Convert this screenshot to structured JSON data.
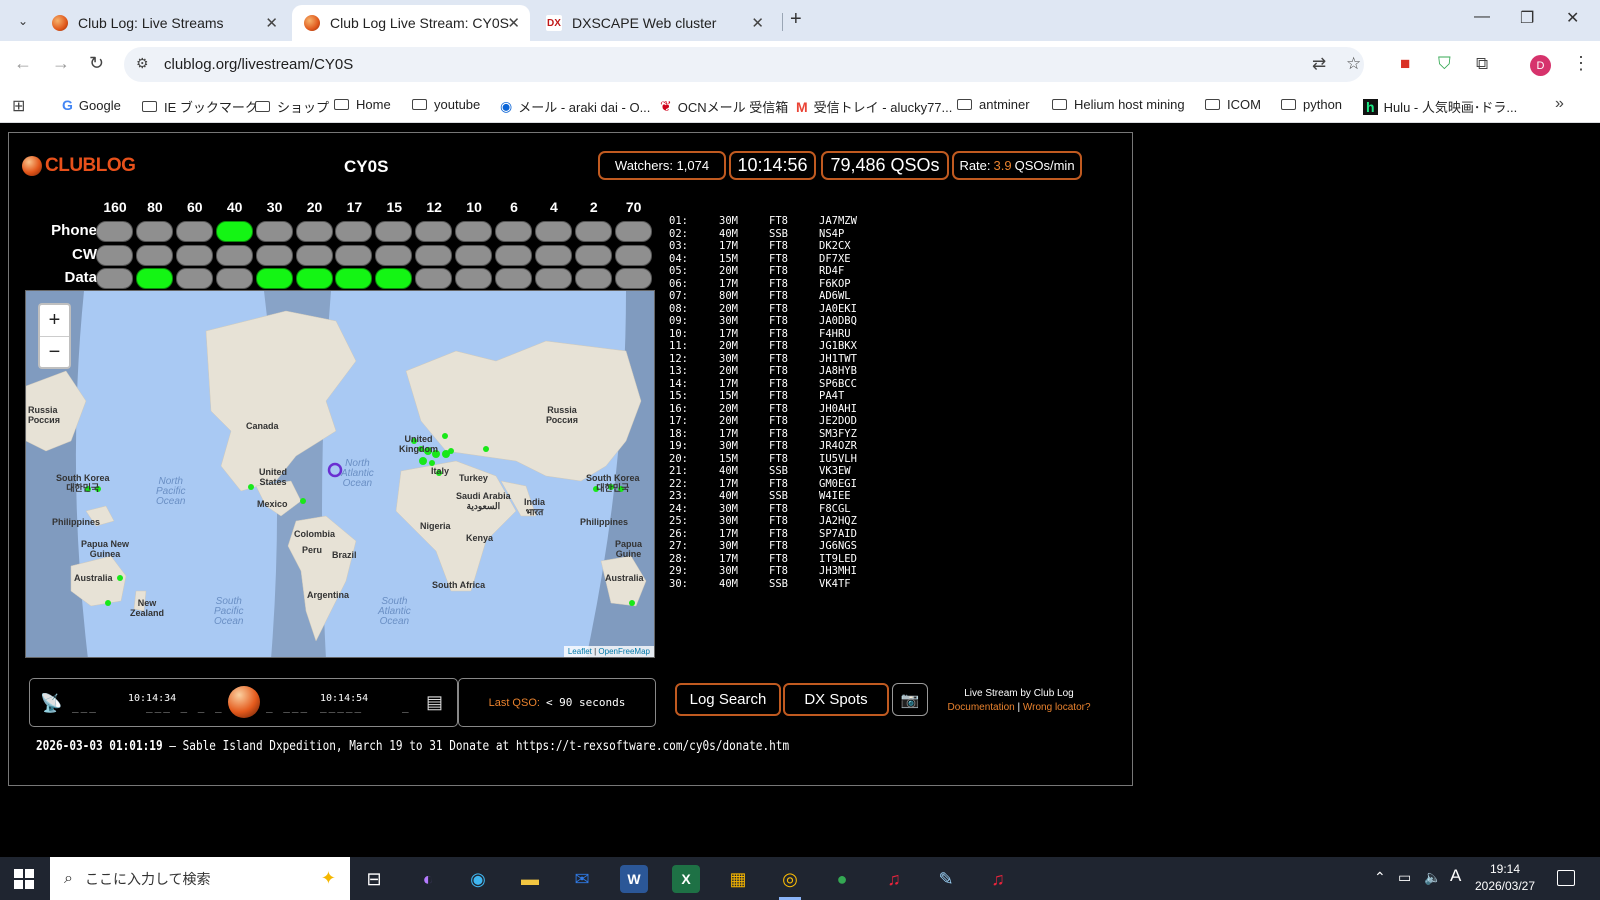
{
  "browser": {
    "tabs": [
      {
        "title": "Club Log: Live Streams",
        "icon": "clublog-favicon"
      },
      {
        "title": "Club Log Live Stream: CY0S",
        "icon": "clublog-favicon"
      },
      {
        "title": "DXSCAPE Web cluster",
        "icon": "dxscape-favicon",
        "icon_text": "DX"
      }
    ],
    "url": "clublog.org/livestream/CY0S",
    "profile_initial": "D",
    "bookmarks": [
      {
        "label": "Google",
        "icon": "google-icon"
      },
      {
        "label": "IE ブックマーク",
        "icon": "folder-icon"
      },
      {
        "label": "ショップ",
        "icon": "folder-icon"
      },
      {
        "label": "Home",
        "icon": "folder-icon"
      },
      {
        "label": "youtube",
        "icon": "folder-icon"
      },
      {
        "label": "メール - araki dai - O...",
        "icon": "outlook-icon"
      },
      {
        "label": "OCNメール 受信箱",
        "icon": "ocn-icon"
      },
      {
        "label": "受信トレイ - alucky77...",
        "icon": "gmail-icon"
      },
      {
        "label": "antminer",
        "icon": "folder-icon"
      },
      {
        "label": "Helium host mining",
        "icon": "folder-icon"
      },
      {
        "label": "ICOM",
        "icon": "folder-icon"
      },
      {
        "label": "python",
        "icon": "folder-icon"
      },
      {
        "label": "Hulu - 人気映画･ドラ...",
        "icon": "hulu-icon"
      }
    ]
  },
  "header": {
    "logo_text_a": "CLUB",
    "logo_text_b": "LOG",
    "callsign": "CY0S",
    "watchers": "Watchers: 1,074",
    "time": "10:14:56",
    "qsos": "79,486 QSOs",
    "rate_label": "Rate:",
    "rate_value": "3.9",
    "rate_unit": "QSOs/min"
  },
  "bands": {
    "labels": [
      "160",
      "80",
      "60",
      "40",
      "30",
      "20",
      "17",
      "15",
      "12",
      "10",
      "6",
      "4",
      "2",
      "70"
    ],
    "modes": [
      {
        "name": "Phone",
        "active": [
          false,
          false,
          false,
          true,
          false,
          false,
          false,
          false,
          false,
          false,
          false,
          false,
          false,
          false
        ]
      },
      {
        "name": "CW",
        "active": [
          false,
          false,
          false,
          false,
          false,
          false,
          false,
          false,
          false,
          false,
          false,
          false,
          false,
          false
        ]
      },
      {
        "name": "Data",
        "active": [
          false,
          true,
          false,
          false,
          true,
          true,
          true,
          true,
          false,
          false,
          false,
          false,
          false,
          false
        ]
      }
    ]
  },
  "map": {
    "zoom_in": "+",
    "zoom_out": "−",
    "attribution_a": "Leaflet",
    "attribution_sep": " | ",
    "attribution_b": "OpenFreeMap",
    "labels": {
      "russia_left": "Russia\nРоссия",
      "canada": "Canada",
      "united_states": "United\nStates",
      "mexico": "Mexico",
      "south_korea_left": "South Korea\n대한민국",
      "philippines_left": "Philippines",
      "png_left": "Papua New\nGuinea",
      "australia_left": "Australia",
      "new_zealand": "New\nZealand",
      "north_pacific": "North\nPacific\nOcean",
      "south_pacific": "South\nPacific\nOcean",
      "north_atlantic": "North\nAtlantic\nOcean",
      "south_atlantic": "South\nAtlantic\nOcean",
      "colombia": "Colombia",
      "peru": "Peru",
      "brazil": "Brazil",
      "argentina": "Argentina",
      "united_kingdom": "United\nKingdom",
      "italy": "Italy",
      "turkey": "Turkey",
      "saudi_arabia": "Saudi Arabia\nالسعودية",
      "india": "India\nभारत",
      "nigeria": "Nigeria",
      "kenya": "Kenya",
      "south_africa": "South Africa",
      "russia_right": "Russia\nРоссия",
      "south_korea_right": "South Korea\n대한민국",
      "philippines_right": "Philippines",
      "png_right": "Papua\nGuine",
      "australia_right": "Australia"
    }
  },
  "qsos": [
    {
      "n": "01:",
      "band": "30M",
      "mode": "FT8",
      "call": "JA7MZW"
    },
    {
      "n": "02:",
      "band": "40M",
      "mode": "SSB",
      "call": "NS4P"
    },
    {
      "n": "03:",
      "band": "17M",
      "mode": "FT8",
      "call": "DK2CX"
    },
    {
      "n": "04:",
      "band": "15M",
      "mode": "FT8",
      "call": "DF7XE"
    },
    {
      "n": "05:",
      "band": "20M",
      "mode": "FT8",
      "call": "RD4F"
    },
    {
      "n": "06:",
      "band": "17M",
      "mode": "FT8",
      "call": "F6KOP"
    },
    {
      "n": "07:",
      "band": "80M",
      "mode": "FT8",
      "call": "AD6WL"
    },
    {
      "n": "08:",
      "band": "20M",
      "mode": "FT8",
      "call": "JA0EKI"
    },
    {
      "n": "09:",
      "band": "30M",
      "mode": "FT8",
      "call": "JA0DBQ"
    },
    {
      "n": "10:",
      "band": "17M",
      "mode": "FT8",
      "call": "F4HRU"
    },
    {
      "n": "11:",
      "band": "20M",
      "mode": "FT8",
      "call": "JG1BKX"
    },
    {
      "n": "12:",
      "band": "30M",
      "mode": "FT8",
      "call": "JH1TWT"
    },
    {
      "n": "13:",
      "band": "20M",
      "mode": "FT8",
      "call": "JA8HYB"
    },
    {
      "n": "14:",
      "band": "17M",
      "mode": "FT8",
      "call": "SP6BCC"
    },
    {
      "n": "15:",
      "band": "15M",
      "mode": "FT8",
      "call": "PA4T"
    },
    {
      "n": "16:",
      "band": "20M",
      "mode": "FT8",
      "call": "JH0AHI"
    },
    {
      "n": "17:",
      "band": "20M",
      "mode": "FT8",
      "call": "JE2DOD"
    },
    {
      "n": "18:",
      "band": "17M",
      "mode": "FT8",
      "call": "SM3FYZ"
    },
    {
      "n": "19:",
      "band": "30M",
      "mode": "FT8",
      "call": "JR4OZR"
    },
    {
      "n": "20:",
      "band": "15M",
      "mode": "FT8",
      "call": "IU5VLH"
    },
    {
      "n": "21:",
      "band": "40M",
      "mode": "SSB",
      "call": "VK3EW"
    },
    {
      "n": "22:",
      "band": "17M",
      "mode": "FT8",
      "call": "GM0EGI"
    },
    {
      "n": "23:",
      "band": "40M",
      "mode": "SSB",
      "call": "W4IEE"
    },
    {
      "n": "24:",
      "band": "30M",
      "mode": "FT8",
      "call": "F8CGL"
    },
    {
      "n": "25:",
      "band": "30M",
      "mode": "FT8",
      "call": "JA2HQZ"
    },
    {
      "n": "26:",
      "band": "17M",
      "mode": "FT8",
      "call": "SP7AID"
    },
    {
      "n": "27:",
      "band": "30M",
      "mode": "FT8",
      "call": "JG6NGS"
    },
    {
      "n": "28:",
      "band": "17M",
      "mode": "FT8",
      "call": "IT9LED"
    },
    {
      "n": "29:",
      "band": "30M",
      "mode": "FT8",
      "call": "JH3MHI"
    },
    {
      "n": "30:",
      "band": "40M",
      "mode": "SSB",
      "call": "VK4TF"
    }
  ],
  "timeline": {
    "time_a": "10:14:34",
    "time_b": "10:14:54",
    "icon_left": "satellite-dish-icon",
    "icon_right": "radio-icon"
  },
  "last_qso": {
    "label": "Last QSO:",
    "value": "< 90 seconds"
  },
  "buttons": {
    "log_search": "Log Search",
    "dx_spots": "DX Spots",
    "camera_icon": "camera-icon"
  },
  "credit": {
    "line1": "Live Stream by Club Log",
    "documentation": "Documentation",
    "sep": " | ",
    "wrong_locator": "Wrong locator?"
  },
  "ticker": {
    "timestamp": "2026-03-03 01:01:19",
    "dash": " — ",
    "message": "Sable Island Dxpedition, March 19 to 31 Donate at https://t-rexsoftware.com/cy0s/donate.htm"
  },
  "taskbar": {
    "search_placeholder": "ここに入力して検索",
    "ime": "A",
    "time": "19:14",
    "date": "2026/03/27"
  },
  "colors": {
    "accent": "#e9822e",
    "border": "#c05a20",
    "band_on": "#14f514",
    "band_off": "#8f8f8f",
    "map_ocean": "#a9c9f3"
  }
}
